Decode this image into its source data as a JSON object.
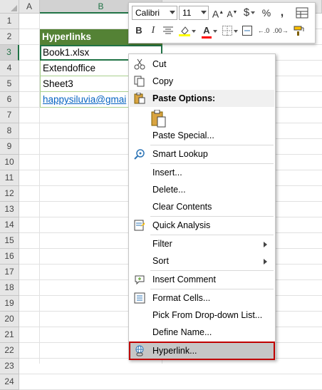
{
  "columns": [
    "A",
    "B"
  ],
  "rows": [
    "1",
    "2",
    "3",
    "4",
    "5",
    "6",
    "7",
    "8",
    "9",
    "10",
    "11",
    "12",
    "13",
    "14",
    "15",
    "16",
    "17",
    "18",
    "19",
    "20",
    "21",
    "22",
    "23",
    "24"
  ],
  "cells": {
    "header": "Hyperlinks",
    "values": [
      "Book1.xlsx",
      "Extendoffice",
      "Sheet3",
      "happysiluvia@gmai"
    ]
  },
  "mini_toolbar": {
    "font_name": "Calibri",
    "font_size": "11"
  },
  "context_menu": {
    "cut": "Cut",
    "copy": "Copy",
    "paste_options": "Paste Options:",
    "paste_special": "Paste Special...",
    "smart_lookup": "Smart Lookup",
    "insert": "Insert...",
    "delete": "Delete...",
    "clear_contents": "Clear Contents",
    "quick_analysis": "Quick Analysis",
    "filter": "Filter",
    "sort": "Sort",
    "insert_comment": "Insert Comment",
    "format_cells": "Format Cells...",
    "pick_list": "Pick From Drop-down List...",
    "define_name": "Define Name...",
    "hyperlink": "Hyperlink..."
  },
  "colors": {
    "header_fill": "#548235",
    "selection_green": "#217346",
    "highlight_border": "#c00000",
    "link_blue": "#0563c1"
  }
}
